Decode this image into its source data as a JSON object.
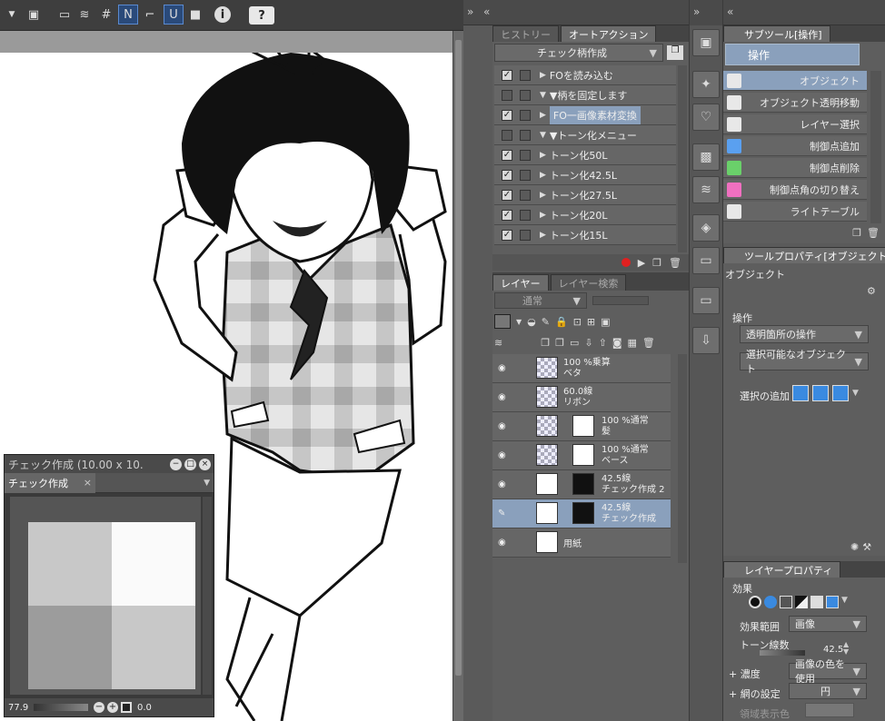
{
  "toolbar": {
    "help_label": "?",
    "info_label": "i"
  },
  "canvas": {},
  "check_window": {
    "title": "チェック作成 (10.00 x 10.",
    "tab": "チェック作成",
    "zoom": "77.9",
    "rotation": "0.0"
  },
  "auto_action": {
    "tabs": [
      "ヒストリー",
      "オートアクション"
    ],
    "set_name": "チェック柄作成",
    "items": [
      {
        "label": "FOを読み込む",
        "checked": true,
        "expand": "▶"
      },
      {
        "label": "▼柄を固定します",
        "checked": false,
        "expand": "▼"
      },
      {
        "label": "FO一画像素材変換",
        "checked": true,
        "expand": "▶",
        "selected": true
      },
      {
        "label": "▼トーン化メニュー",
        "checked": false,
        "expand": "▼"
      },
      {
        "label": "トーン化50L",
        "checked": true,
        "expand": "▶"
      },
      {
        "label": "トーン化42.5L",
        "checked": true,
        "expand": "▶"
      },
      {
        "label": "トーン化27.5L",
        "checked": true,
        "expand": "▶"
      },
      {
        "label": "トーン化20L",
        "checked": true,
        "expand": "▶"
      },
      {
        "label": "トーン化15L",
        "checked": true,
        "expand": "▶"
      }
    ]
  },
  "layers": {
    "tabs": [
      "レイヤー",
      "レイヤー検索"
    ],
    "blend_mode": "通常",
    "items": [
      {
        "line1": "100 %乗算",
        "line2": "ベタ"
      },
      {
        "line1": "60.0線",
        "line2": "リボン"
      },
      {
        "line1": "100 %通常",
        "line2": "髪"
      },
      {
        "line1": "100 %通常",
        "line2": "ベース"
      },
      {
        "line1": "42.5線",
        "line2": "チェック作成 2"
      },
      {
        "line1": "42.5線",
        "line2": "チェック作成",
        "selected": true
      },
      {
        "line1": "",
        "line2": "用紙"
      }
    ]
  },
  "subtool": {
    "header": "サブツール[操作]",
    "group": "操作",
    "items": [
      {
        "label": "オブジェクト",
        "color": "#e8e8e8",
        "selected": true
      },
      {
        "label": "オブジェクト透明移動",
        "color": "#e8e8e8"
      },
      {
        "label": "レイヤー選択",
        "color": "#e8e8e8"
      },
      {
        "label": "制御点追加",
        "color": "#5aa0f0"
      },
      {
        "label": "制御点削除",
        "color": "#6ad06a"
      },
      {
        "label": "制御点角の切り替え",
        "color": "#f070c0"
      },
      {
        "label": "ライトテーブル",
        "color": "#e8e8e8"
      }
    ]
  },
  "tool_property": {
    "header": "ツールプロパティ[オブジェクト]",
    "object_label": "オブジェクト",
    "section": "操作",
    "transparent_op": "透明箇所の操作",
    "selectable": "選択可能なオブジェクト",
    "add_selection": "選択の追加"
  },
  "layer_property": {
    "header": "レイヤープロパティ",
    "effect": "効果",
    "effect_range_label": "効果範囲",
    "effect_range_value": "画像",
    "tone_lines_label": "トーン線数",
    "tone_lines_value": "42.5",
    "density_label": "濃度",
    "density_value": "画像の色を使用",
    "screen_label": "網の設定",
    "screen_value": "円",
    "area_label": "領域表示色"
  }
}
